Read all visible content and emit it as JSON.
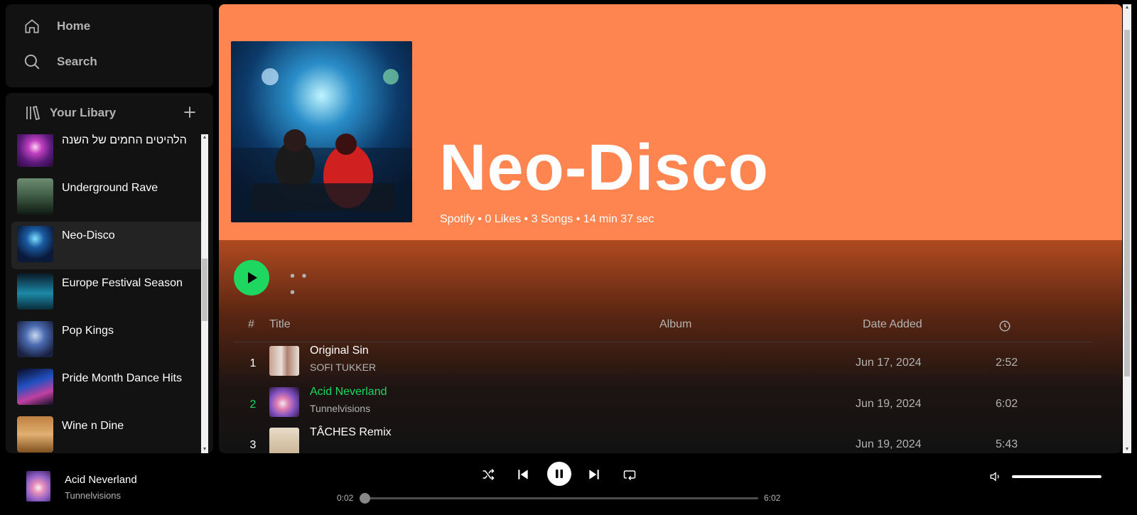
{
  "colors": {
    "accent": "#1ed760",
    "header_bg": "#fe8450",
    "panel_bg": "#121212"
  },
  "nav": {
    "home_label": "Home",
    "search_label": "Search"
  },
  "library": {
    "title": "Your Libary",
    "items": [
      {
        "name": "הלהיטים החמים של השנה",
        "thumb": "pink-performer"
      },
      {
        "name": "Underground Rave",
        "thumb": "green-crowd"
      },
      {
        "name": "Neo-Disco",
        "thumb": "blue-club",
        "active": true
      },
      {
        "name": "Europe Festival Season",
        "thumb": "cyan-stage"
      },
      {
        "name": "Pop Kings",
        "thumb": "blue-performer"
      },
      {
        "name": "Pride Month Dance Hits",
        "thumb": "laser-stage"
      },
      {
        "name": "Wine n Dine",
        "thumb": "food"
      }
    ]
  },
  "playlist": {
    "title": "Neo-Disco",
    "meta": "Spotify • 0 Likes • 3 Songs • 14 min 37 sec",
    "more": "• • •"
  },
  "table": {
    "headers": {
      "num": "#",
      "title": "Title",
      "album": "Album",
      "date": "Date Added"
    },
    "rows": [
      {
        "num": "1",
        "title": "Original Sin",
        "artist": "SOFI TUKKER",
        "album": "",
        "date": "Jun 17, 2024",
        "duration": "2:52"
      },
      {
        "num": "2",
        "title": "Acid Neverland",
        "artist": "Tunnelvisions",
        "album": "",
        "date": "Jun 19, 2024",
        "duration": "6:02",
        "playing": true
      },
      {
        "num": "3",
        "title": "TÂCHES Remix",
        "artist": "",
        "album": "",
        "date": "Jun 19, 2024",
        "duration": "5:43"
      }
    ]
  },
  "player": {
    "title": "Acid Neverland",
    "artist": "Tunnelvisions",
    "elapsed": "0:02",
    "total": "6:02",
    "progress_fraction": 0.006,
    "volume_fraction": 1.0
  }
}
